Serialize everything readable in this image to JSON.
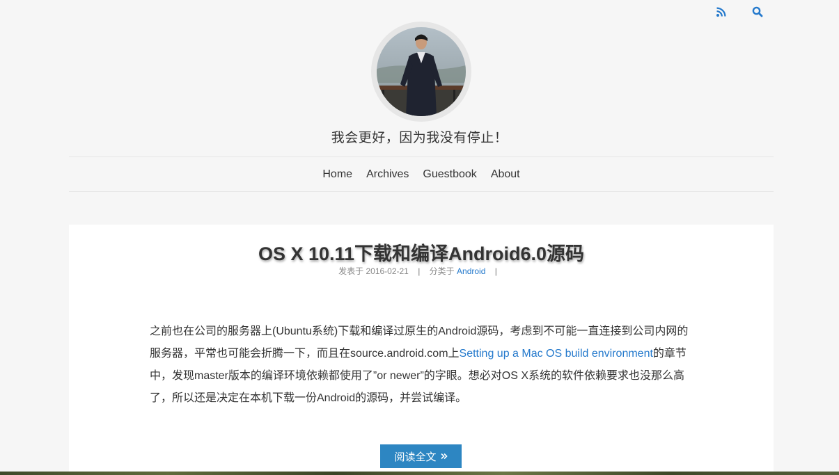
{
  "header": {
    "icons": [
      "rss-icon",
      "search-icon"
    ],
    "tagline": "我会更好，因为我没有停止！"
  },
  "nav": {
    "items": [
      {
        "label": "Home"
      },
      {
        "label": "Archives"
      },
      {
        "label": "Guestbook"
      },
      {
        "label": "About"
      }
    ]
  },
  "post": {
    "title": "OS X 10.11下载和编译Android6.0源码",
    "meta": {
      "published_prefix": "发表于",
      "date": "2016-02-21",
      "category_prefix": "分类于",
      "category": "Android",
      "separator": "|"
    },
    "excerpt": {
      "part1": "之前也在公司的服务器上(Ubuntu系统)下载和编译过原生的Android源码，考虑到不可能一直连接到公司内网的服务器，平常也可能会折腾一下，而且在source.android.com上",
      "link": "Setting up a Mac OS build environment",
      "part2": "的章节中，发现master版本的编译环境依赖都使用了”or newer”的字眼。想必对OS X系统的软件依赖要求也没那么高了，所以还是决定在本机下载一份Android的源码，并尝试编译。"
    },
    "read_more": {
      "label": "阅读全文",
      "icon": "double-chevron-right-icon"
    }
  },
  "colors": {
    "accent": "#2479cc",
    "button": "#2d86c2",
    "background": "#f6f6f6"
  }
}
